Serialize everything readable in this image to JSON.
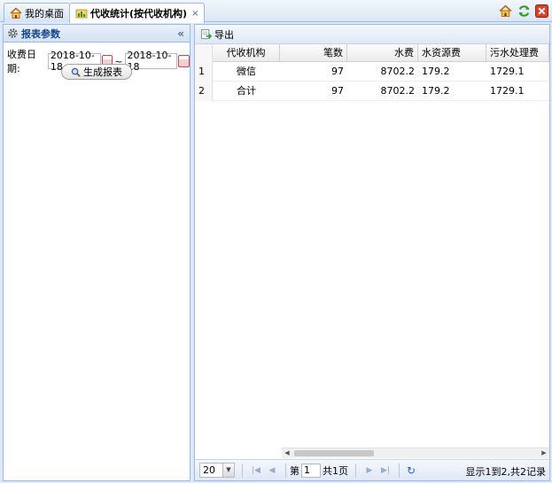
{
  "tabs": [
    {
      "label": "我的桌面"
    },
    {
      "label": "代收统计(按代收机构)",
      "close": "×"
    }
  ],
  "left_panel": {
    "title": "报表参数",
    "collapse": "«",
    "date_label": "收费日期:",
    "start_date": "2018-10-18",
    "separator": "~",
    "end_date": "2018-10-18",
    "generate_button": "生成报表"
  },
  "toolbar": {
    "export_label": "导出"
  },
  "grid": {
    "columns": [
      "代收机构",
      "笔数",
      "水费",
      "水资源费",
      "污水处理费"
    ],
    "rows": [
      {
        "num": "1",
        "org": "微信",
        "count": "97",
        "water_fee": "8702.2",
        "resource_fee": "179.2",
        "sewage_fee": "1729.1"
      },
      {
        "num": "2",
        "org": "合计",
        "count": "97",
        "water_fee": "8702.2",
        "resource_fee": "179.2",
        "sewage_fee": "1729.1"
      }
    ]
  },
  "pager": {
    "page_size": "20",
    "page_prefix": "第",
    "page_value": "1",
    "page_suffix": "共1页",
    "info": "显示1到2,共2记录"
  },
  "colors": {
    "border": "#99bbe8",
    "header_text": "#15428b"
  }
}
